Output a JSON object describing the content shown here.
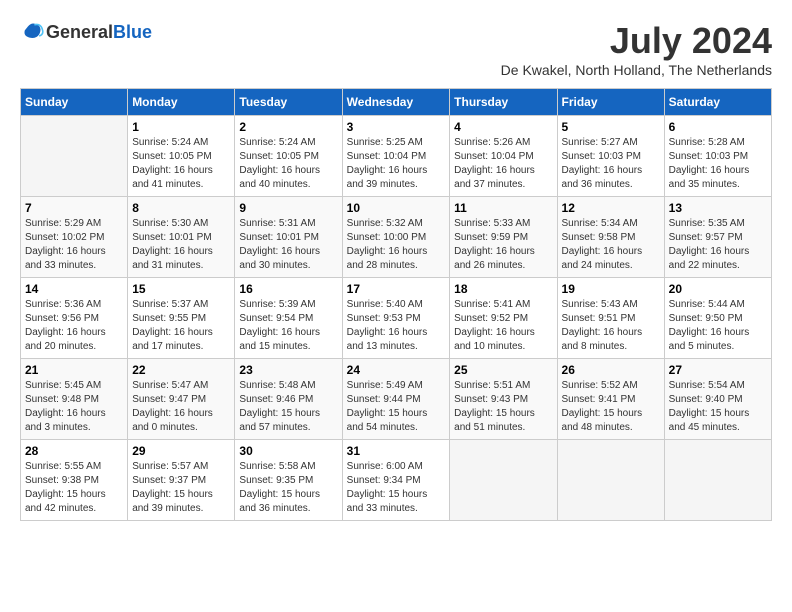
{
  "header": {
    "logo_general": "General",
    "logo_blue": "Blue",
    "month_year": "July 2024",
    "location": "De Kwakel, North Holland, The Netherlands"
  },
  "days_of_week": [
    "Sunday",
    "Monday",
    "Tuesday",
    "Wednesday",
    "Thursday",
    "Friday",
    "Saturday"
  ],
  "weeks": [
    [
      {
        "day": "",
        "sunrise": "",
        "sunset": "",
        "daylight": ""
      },
      {
        "day": "1",
        "sunrise": "Sunrise: 5:24 AM",
        "sunset": "Sunset: 10:05 PM",
        "daylight": "Daylight: 16 hours and 41 minutes."
      },
      {
        "day": "2",
        "sunrise": "Sunrise: 5:24 AM",
        "sunset": "Sunset: 10:05 PM",
        "daylight": "Daylight: 16 hours and 40 minutes."
      },
      {
        "day": "3",
        "sunrise": "Sunrise: 5:25 AM",
        "sunset": "Sunset: 10:04 PM",
        "daylight": "Daylight: 16 hours and 39 minutes."
      },
      {
        "day": "4",
        "sunrise": "Sunrise: 5:26 AM",
        "sunset": "Sunset: 10:04 PM",
        "daylight": "Daylight: 16 hours and 37 minutes."
      },
      {
        "day": "5",
        "sunrise": "Sunrise: 5:27 AM",
        "sunset": "Sunset: 10:03 PM",
        "daylight": "Daylight: 16 hours and 36 minutes."
      },
      {
        "day": "6",
        "sunrise": "Sunrise: 5:28 AM",
        "sunset": "Sunset: 10:03 PM",
        "daylight": "Daylight: 16 hours and 35 minutes."
      }
    ],
    [
      {
        "day": "7",
        "sunrise": "Sunrise: 5:29 AM",
        "sunset": "Sunset: 10:02 PM",
        "daylight": "Daylight: 16 hours and 33 minutes."
      },
      {
        "day": "8",
        "sunrise": "Sunrise: 5:30 AM",
        "sunset": "Sunset: 10:01 PM",
        "daylight": "Daylight: 16 hours and 31 minutes."
      },
      {
        "day": "9",
        "sunrise": "Sunrise: 5:31 AM",
        "sunset": "Sunset: 10:01 PM",
        "daylight": "Daylight: 16 hours and 30 minutes."
      },
      {
        "day": "10",
        "sunrise": "Sunrise: 5:32 AM",
        "sunset": "Sunset: 10:00 PM",
        "daylight": "Daylight: 16 hours and 28 minutes."
      },
      {
        "day": "11",
        "sunrise": "Sunrise: 5:33 AM",
        "sunset": "Sunset: 9:59 PM",
        "daylight": "Daylight: 16 hours and 26 minutes."
      },
      {
        "day": "12",
        "sunrise": "Sunrise: 5:34 AM",
        "sunset": "Sunset: 9:58 PM",
        "daylight": "Daylight: 16 hours and 24 minutes."
      },
      {
        "day": "13",
        "sunrise": "Sunrise: 5:35 AM",
        "sunset": "Sunset: 9:57 PM",
        "daylight": "Daylight: 16 hours and 22 minutes."
      }
    ],
    [
      {
        "day": "14",
        "sunrise": "Sunrise: 5:36 AM",
        "sunset": "Sunset: 9:56 PM",
        "daylight": "Daylight: 16 hours and 20 minutes."
      },
      {
        "day": "15",
        "sunrise": "Sunrise: 5:37 AM",
        "sunset": "Sunset: 9:55 PM",
        "daylight": "Daylight: 16 hours and 17 minutes."
      },
      {
        "day": "16",
        "sunrise": "Sunrise: 5:39 AM",
        "sunset": "Sunset: 9:54 PM",
        "daylight": "Daylight: 16 hours and 15 minutes."
      },
      {
        "day": "17",
        "sunrise": "Sunrise: 5:40 AM",
        "sunset": "Sunset: 9:53 PM",
        "daylight": "Daylight: 16 hours and 13 minutes."
      },
      {
        "day": "18",
        "sunrise": "Sunrise: 5:41 AM",
        "sunset": "Sunset: 9:52 PM",
        "daylight": "Daylight: 16 hours and 10 minutes."
      },
      {
        "day": "19",
        "sunrise": "Sunrise: 5:43 AM",
        "sunset": "Sunset: 9:51 PM",
        "daylight": "Daylight: 16 hours and 8 minutes."
      },
      {
        "day": "20",
        "sunrise": "Sunrise: 5:44 AM",
        "sunset": "Sunset: 9:50 PM",
        "daylight": "Daylight: 16 hours and 5 minutes."
      }
    ],
    [
      {
        "day": "21",
        "sunrise": "Sunrise: 5:45 AM",
        "sunset": "Sunset: 9:48 PM",
        "daylight": "Daylight: 16 hours and 3 minutes."
      },
      {
        "day": "22",
        "sunrise": "Sunrise: 5:47 AM",
        "sunset": "Sunset: 9:47 PM",
        "daylight": "Daylight: 16 hours and 0 minutes."
      },
      {
        "day": "23",
        "sunrise": "Sunrise: 5:48 AM",
        "sunset": "Sunset: 9:46 PM",
        "daylight": "Daylight: 15 hours and 57 minutes."
      },
      {
        "day": "24",
        "sunrise": "Sunrise: 5:49 AM",
        "sunset": "Sunset: 9:44 PM",
        "daylight": "Daylight: 15 hours and 54 minutes."
      },
      {
        "day": "25",
        "sunrise": "Sunrise: 5:51 AM",
        "sunset": "Sunset: 9:43 PM",
        "daylight": "Daylight: 15 hours and 51 minutes."
      },
      {
        "day": "26",
        "sunrise": "Sunrise: 5:52 AM",
        "sunset": "Sunset: 9:41 PM",
        "daylight": "Daylight: 15 hours and 48 minutes."
      },
      {
        "day": "27",
        "sunrise": "Sunrise: 5:54 AM",
        "sunset": "Sunset: 9:40 PM",
        "daylight": "Daylight: 15 hours and 45 minutes."
      }
    ],
    [
      {
        "day": "28",
        "sunrise": "Sunrise: 5:55 AM",
        "sunset": "Sunset: 9:38 PM",
        "daylight": "Daylight: 15 hours and 42 minutes."
      },
      {
        "day": "29",
        "sunrise": "Sunrise: 5:57 AM",
        "sunset": "Sunset: 9:37 PM",
        "daylight": "Daylight: 15 hours and 39 minutes."
      },
      {
        "day": "30",
        "sunrise": "Sunrise: 5:58 AM",
        "sunset": "Sunset: 9:35 PM",
        "daylight": "Daylight: 15 hours and 36 minutes."
      },
      {
        "day": "31",
        "sunrise": "Sunrise: 6:00 AM",
        "sunset": "Sunset: 9:34 PM",
        "daylight": "Daylight: 15 hours and 33 minutes."
      },
      {
        "day": "",
        "sunrise": "",
        "sunset": "",
        "daylight": ""
      },
      {
        "day": "",
        "sunrise": "",
        "sunset": "",
        "daylight": ""
      },
      {
        "day": "",
        "sunrise": "",
        "sunset": "",
        "daylight": ""
      }
    ]
  ]
}
